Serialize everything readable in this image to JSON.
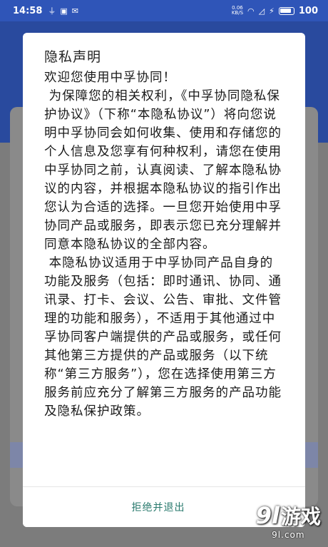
{
  "status_bar": {
    "time": "14:58",
    "net_speed": "0.06",
    "net_unit": "KB/S",
    "battery": "100"
  },
  "dialog": {
    "title": "隐私声明",
    "paragraphs": [
      "欢迎您使用中孚协同！",
      " 为保障您的相关权利，《中孚协同隐私保护协议》（下称“本隐私协议”）将向您说明中孚协同会如何收集、使用和存储您的个人信息及您享有何种权利，请您在使用中孚协同之前，认真阅读、了解本隐私协议的内容，并根据本隐私协议的指引作出您认为合适的选择。一旦您开始使用中孚协同产品或服务，即表示您已充分理解并同意本隐私协议的全部内容。",
      " 本隐私协议适用于中孚协同产品自身的功能及服务（包括：即时通讯、协同、通讯录、打卡、会议、公告、审批、文件管理的功能和服务），不适用于其他通过中孚协同客户端提供的产品或服务，或任何其他第三方提供的产品或服务（以下统称“第三方服务”），您在选择使用第三方服务前应充分了解第三方服务的产品功能及隐私保护政策。"
    ],
    "decline_label": "拒绝并退出"
  },
  "watermark": {
    "logo": "9l",
    "text": "游戏",
    "url": "9l.com"
  },
  "colors": {
    "header_blue": "#2f55b8",
    "accent_text": "#2a7a6e"
  }
}
